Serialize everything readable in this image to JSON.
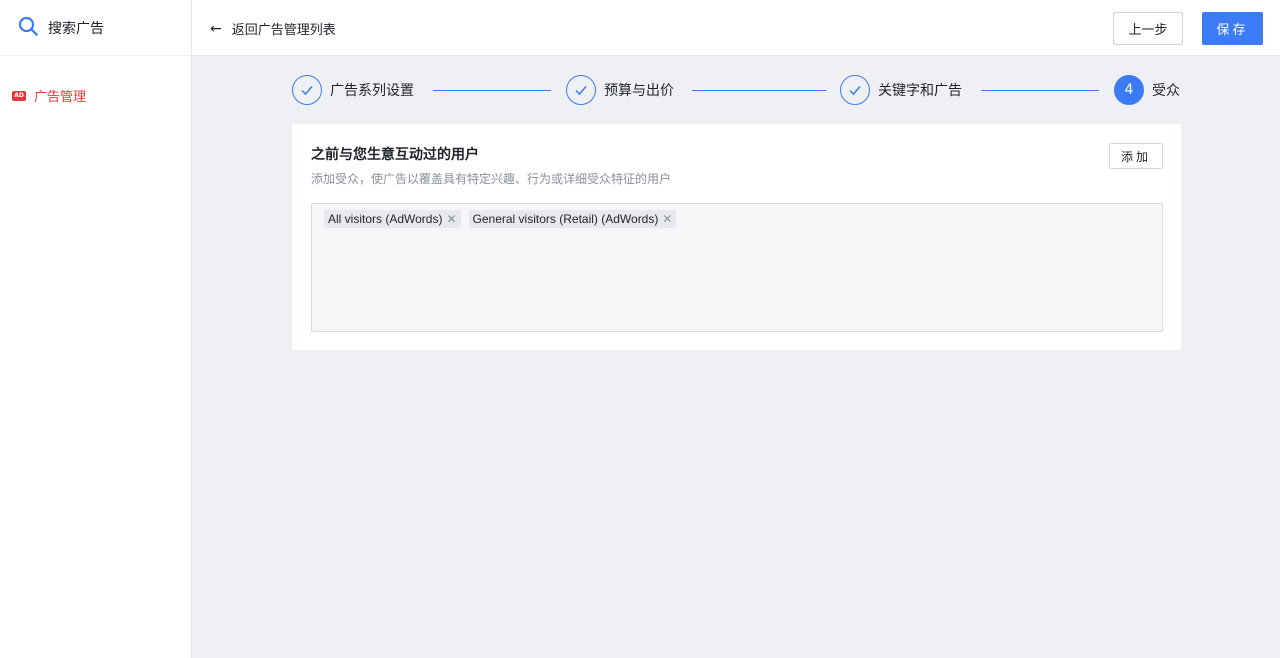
{
  "sidebar": {
    "app_title": "搜索广告",
    "items": [
      {
        "label": "广告管理",
        "icon": "ad-icon",
        "icon_text": "AD",
        "active": true,
        "color": "#e53935"
      }
    ]
  },
  "header": {
    "back_label": "返回广告管理列表",
    "prev_label": "上一步",
    "save_label": "保存"
  },
  "stepper": {
    "steps": [
      {
        "label": "广告系列设置",
        "status": "done"
      },
      {
        "label": "预算与出价",
        "status": "done"
      },
      {
        "label": "关键字和广告",
        "status": "done"
      },
      {
        "label": "受众",
        "status": "active",
        "number": "4"
      }
    ]
  },
  "audience": {
    "title": "之前与您生意互动过的用户",
    "description": "添加受众，使广告以覆盖具有特定兴趣、行为或详细受众特征的用户",
    "add_label": "添加",
    "tags": [
      {
        "label": "All visitors (AdWords)"
      },
      {
        "label": "General visitors (Retail) (AdWords)"
      }
    ]
  },
  "colors": {
    "primary": "#3b7cf6",
    "danger": "#e53935",
    "background": "#eef0f4"
  }
}
